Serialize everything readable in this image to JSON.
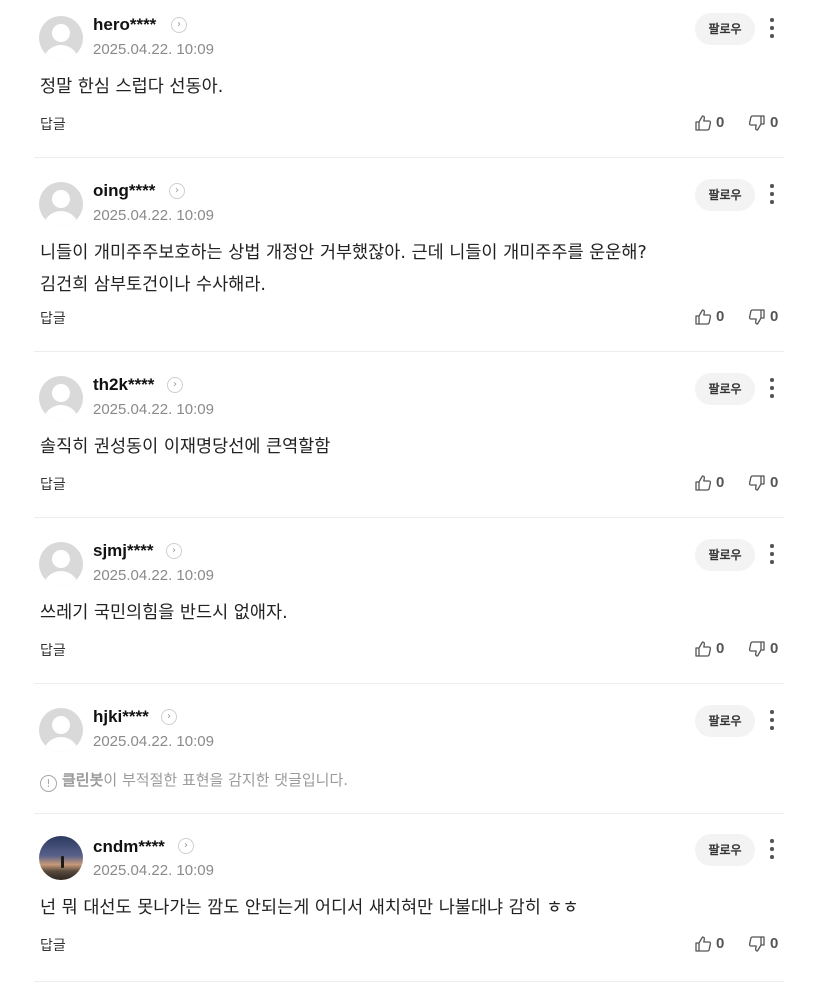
{
  "ui": {
    "follow_label": "팔로우",
    "reply_label": "답글"
  },
  "comments": [
    {
      "nickname": "hero****",
      "date": "2025.04.22. 10:09",
      "text": "정말 한심 스럽다 선동아.",
      "likes": "0",
      "dislikes": "0"
    },
    {
      "nickname": "oing****",
      "date": "2025.04.22. 10:09",
      "text": "니들이 개미주주보호하는 상법 개정안 거부했잖아. 근데 니들이 개미주주를 운운해?\n김건희 삼부토건이나 수사해라.",
      "likes": "0",
      "dislikes": "0"
    },
    {
      "nickname": "th2k****",
      "date": "2025.04.22. 10:09",
      "text": "솔직히 권성동이 이재명당선에 큰역할함",
      "likes": "0",
      "dislikes": "0"
    },
    {
      "nickname": "sjmj****",
      "date": "2025.04.22. 10:09",
      "text": "쓰레기 국민의힘을 반드시 없애자.",
      "likes": "0",
      "dislikes": "0"
    },
    {
      "nickname": "hjki****",
      "date": "2025.04.22. 10:09",
      "cleanbot_name": "클린봇",
      "cleanbot_text": "이 부적절한 표현을 감지한 댓글입니다."
    },
    {
      "nickname": "cndm****",
      "date": "2025.04.22. 10:09",
      "text": "넌 뭐 대선도 못나가는 깜도 안되는게 어디서 새치혀만 나불대냐 감히 ㅎㅎ",
      "likes": "0",
      "dislikes": "0"
    }
  ]
}
